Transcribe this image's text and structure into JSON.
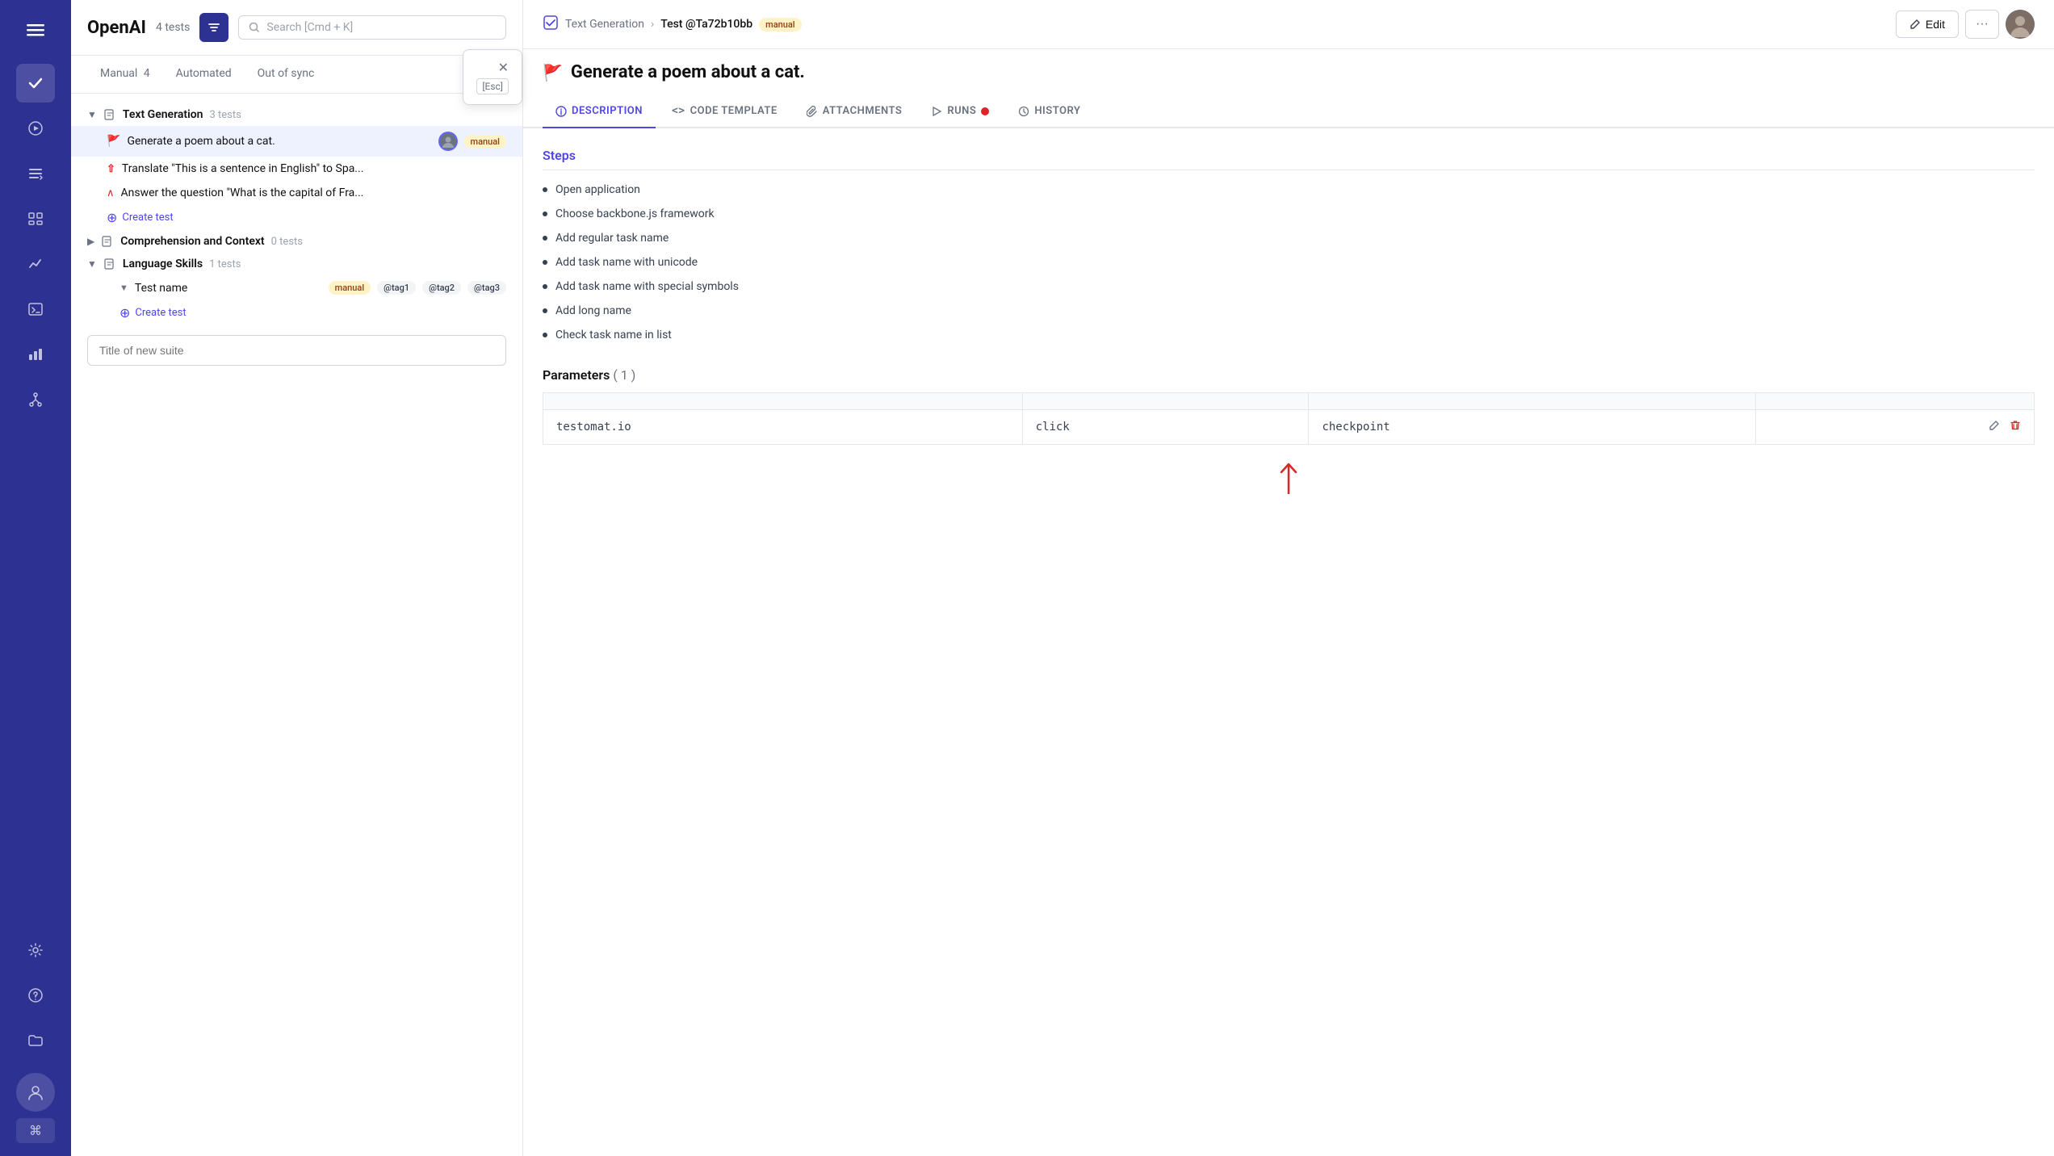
{
  "app": {
    "name": "OpenAI",
    "tests_count": "4 tests",
    "filter_icon": "▼",
    "search_placeholder": "Search [Cmd + K]"
  },
  "sidebar": {
    "items": [
      {
        "id": "home",
        "icon": "☰",
        "label": "Menu"
      },
      {
        "id": "check",
        "icon": "✓",
        "label": "Check",
        "active": true
      },
      {
        "id": "play",
        "icon": "▶",
        "label": "Play"
      },
      {
        "id": "list",
        "icon": "≡",
        "label": "List"
      },
      {
        "id": "steps",
        "icon": "⤵",
        "label": "Steps"
      },
      {
        "id": "analytics",
        "icon": "⚡",
        "label": "Analytics"
      },
      {
        "id": "terminal",
        "icon": "▣",
        "label": "Terminal"
      },
      {
        "id": "chart",
        "icon": "▦",
        "label": "Chart"
      },
      {
        "id": "fork",
        "icon": "⑂",
        "label": "Fork"
      },
      {
        "id": "settings",
        "icon": "⚙",
        "label": "Settings"
      },
      {
        "id": "help",
        "icon": "?",
        "label": "Help"
      },
      {
        "id": "folder",
        "icon": "📁",
        "label": "Folder"
      }
    ]
  },
  "tabs": {
    "items": [
      {
        "id": "manual",
        "label": "Manual",
        "count": "4",
        "active": false
      },
      {
        "id": "automated",
        "label": "Automated",
        "count": "",
        "active": false
      },
      {
        "id": "out-of-sync",
        "label": "Out of sync",
        "count": "",
        "active": false
      }
    ],
    "esc_label": "[Esc]"
  },
  "tree": {
    "suites": [
      {
        "id": "text-generation",
        "name": "Text Generation",
        "count": "3 tests",
        "expanded": true,
        "tests": [
          {
            "id": "poem",
            "name": "Generate a poem about a cat.",
            "selected": true,
            "badge": "manual",
            "has_avatar": true,
            "has_flag": true
          },
          {
            "id": "translate",
            "name": "Translate \"This is a sentence in English\" to Spa",
            "selected": false,
            "has_arrow": true
          },
          {
            "id": "capital",
            "name": "Answer the question \"What is the capital of Fra",
            "selected": false,
            "has_arrow": true
          }
        ],
        "create_test_label": "Create test"
      },
      {
        "id": "comprehension",
        "name": "Comprehension and Context",
        "count": "0 tests",
        "expanded": false,
        "tests": []
      },
      {
        "id": "language-skills",
        "name": "Language Skills",
        "count": "1 tests",
        "expanded": true,
        "tests": [
          {
            "id": "test-name",
            "name": "Test name",
            "selected": false,
            "badge": "manual",
            "tags": [
              "@tag1",
              "@tag2",
              "@tag3"
            ]
          }
        ],
        "create_test_label": "Create test"
      }
    ],
    "new_suite_placeholder": "Title of new suite"
  },
  "right_panel": {
    "breadcrumb": {
      "parent": "Text Generation",
      "current": "Test @Ta72b10bb",
      "badge": "manual",
      "icon": "☑"
    },
    "buttons": {
      "edit": "Edit",
      "more": "···"
    },
    "test_title": "Generate a poem about a cat.",
    "tabs": [
      {
        "id": "description",
        "label": "DESCRIPTION",
        "active": true,
        "icon": "ℹ"
      },
      {
        "id": "code-template",
        "label": "CODE TEMPLATE",
        "active": false,
        "icon": "<>"
      },
      {
        "id": "attachments",
        "label": "ATTACHMENTS",
        "active": false,
        "icon": "📎"
      },
      {
        "id": "runs",
        "label": "RUNS",
        "active": false,
        "icon": "▶",
        "has_badge": true
      },
      {
        "id": "history",
        "label": "HISTORY",
        "active": false,
        "icon": "🕐"
      }
    ],
    "description": {
      "steps_title": "Steps",
      "steps": [
        "Open application",
        "Choose backbone.js framework",
        "Add regular task name",
        "Add task name with unicode",
        "Add task name with special symbols",
        "Add long name",
        "Check task name in list"
      ],
      "parameters": {
        "title": "Parameters",
        "count": "( 1 )",
        "columns": [
          "",
          "",
          "",
          ""
        ],
        "rows": [
          {
            "col1": "testomat.io",
            "col2": "click",
            "col3": "checkpoint"
          }
        ]
      }
    }
  }
}
